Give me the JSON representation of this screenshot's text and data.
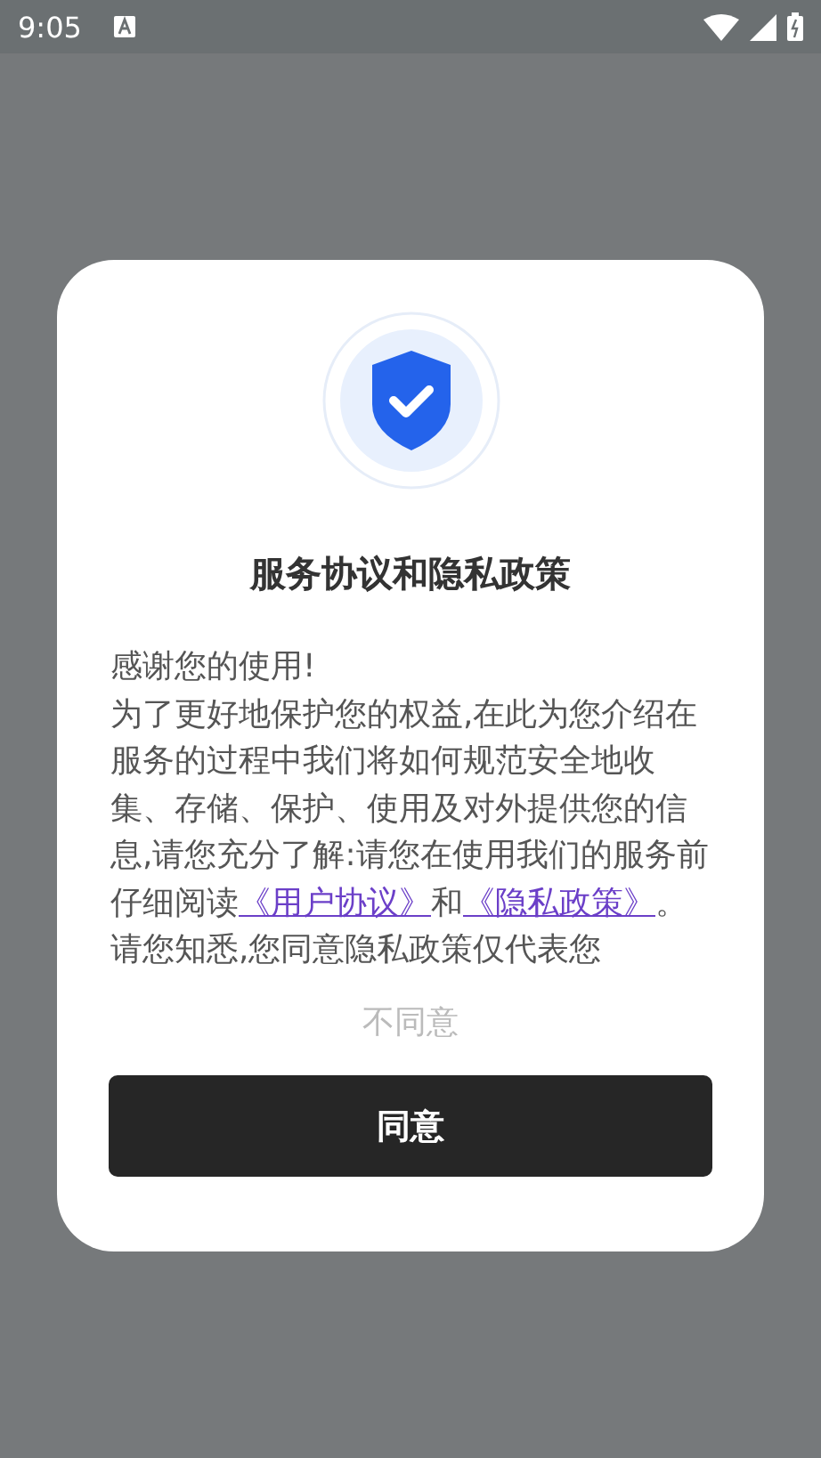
{
  "status_bar": {
    "time": "9:05"
  },
  "dialog": {
    "title": "服务协议和隐私政策",
    "greeting": "感谢您的使用!",
    "parts": [
      {
        "kind": "text",
        "text": "为了更好地保护您的权益,在此为您介绍在服务的过程中我们将如何规范安全地收集、存储、保护、使用及对外提供您的信息,请您充分了解:请您在使用我们的服务前仔细阅读"
      },
      {
        "kind": "link",
        "text": "《用户协议》"
      },
      {
        "kind": "text",
        "text": "和"
      },
      {
        "kind": "link",
        "text": "《隐私政策》"
      },
      {
        "kind": "text",
        "text": "。请您知悉,您同意隐私政策仅代表您"
      }
    ],
    "decline": "不同意",
    "accept": "同意"
  }
}
